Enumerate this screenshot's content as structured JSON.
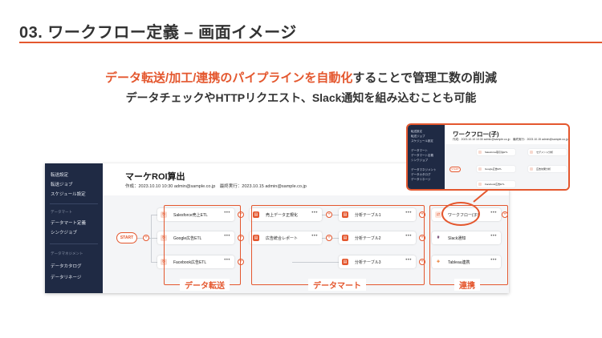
{
  "slide": {
    "title": "03. ワークフロー定義 – 画面イメージ",
    "headline_accent": "データ転送/加工/連携のパイプラインを自動化",
    "headline_rest": "することで管理工数の削減",
    "subline": "データチェックやHTTPリクエスト、Slack通知を組み込むことも可能"
  },
  "sidebar": {
    "items": [
      "転送設定",
      "転送ジョブ",
      "スケジュール設定"
    ],
    "section_mart": "データマート",
    "mart_items": [
      "データマート定義",
      "シンクジョブ"
    ],
    "section_dm": "データマネジメント",
    "dm_items": [
      "データカタログ",
      "データリネージ"
    ]
  },
  "workflow": {
    "title": "マーケROI算出",
    "meta": "作成：2023.10.10 10:30 admin@sample.co.jp　最終実行：2023.10.15 admin@sample.co.jp",
    "start_label": "START",
    "transfer_nodes": [
      "Salesforce売上ETL",
      "Google広告ETL",
      "Facebook広告ETL"
    ],
    "mart_col1": [
      "売上データ正規化",
      "広告統合レポート"
    ],
    "mart_col2": [
      "分析テーブル1",
      "分析テーブル2",
      "分析テーブル3"
    ],
    "link_nodes": [
      "ワークフロー(子)",
      "Slack通知",
      "Tableau連携"
    ],
    "dots": "•••",
    "plus": "+"
  },
  "stages": {
    "transfer": "データ転送",
    "mart": "データマート",
    "link": "連携"
  },
  "popup": {
    "title": "ワークフロー(子)",
    "meta": "作成：2023.10.10 10:30 admin@sample.co.jp　最終実行：2023.10.15 admin@sample.co.jp",
    "sidebar_items": [
      "転送設定",
      "転送ジョブ",
      "スケジュール設定",
      "データマート",
      "データマート定義",
      "シンクジョブ",
      "データマネジメント",
      "データカタログ",
      "データリネージ"
    ],
    "start_label": "START",
    "nodes_left": [
      "Salesforce取引先ETL",
      "Google広告ETL",
      "Facebook広告ETL"
    ],
    "nodes_right": [
      "セグメント分析",
      "広告効果分析"
    ]
  },
  "colors": {
    "accent": "#e4572e",
    "sidebar": "#1f2a44"
  }
}
